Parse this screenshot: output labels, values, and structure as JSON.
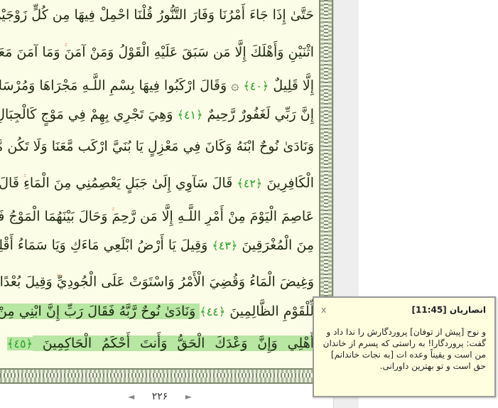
{
  "quran": {
    "lines": [
      {
        "parts": [
          {
            "t": "حَتَّىٰ إِذَا جَاءَ أَمْرُنَا وَفَارَ التَّنُّورُ قُلْنَا احْمِلْ فِيهَا مِن كُلٍّ زَوْجَيْنِ"
          }
        ]
      },
      {
        "parts": [
          {
            "t": "اثْنَيْنِ وَأَهْلَكَ إِلَّا مَن سَبَقَ عَلَيْهِ الْقَوْلُ وَمَنْ آمَنَ"
          },
          {
            "w": "ۚ"
          },
          {
            "t": " وَمَا آمَنَ مَعَهُ"
          }
        ]
      },
      {
        "parts": [
          {
            "t": "إِلَّا قَلِيلٌ "
          },
          {
            "a": "﴿٤٠﴾"
          },
          {
            "t": " ۞ وَقَالَ ارْكَبُوا فِيهَا بِسْمِ اللَّـهِ مَجْرَاهَا وَمُرْسَاهَا"
          },
          {
            "w": "ۚ"
          }
        ]
      },
      {
        "parts": [
          {
            "t": "إِنَّ رَبِّي لَغَفُورٌ رَّحِيمٌ "
          },
          {
            "a": "﴿٤١﴾"
          },
          {
            "t": " وَهِيَ تَجْرِي بِهِمْ فِي مَوْجٍ كَالْجِبَالِ"
          }
        ]
      },
      {
        "parts": [
          {
            "t": "وَنَادَىٰ نُوحٌ ابْنَهُ وَكَانَ فِي مَعْزِلٍ يَا بُنَيَّ ارْكَب مَّعَنَا وَلَا تَكُن مَّعَ"
          }
        ]
      },
      {
        "parts": [
          {
            "t": "الْكَافِرِينَ "
          },
          {
            "a": "﴿٤٢﴾"
          },
          {
            "t": " قَالَ سَآوِي إِلَىٰ جَبَلٍ يَعْصِمُنِي مِنَ الْمَاءِ"
          },
          {
            "w": "ۚ"
          },
          {
            "t": " قَالَ لَا"
          }
        ]
      },
      {
        "parts": [
          {
            "t": "عَاصِمَ الْيَوْمَ مِنْ أَمْرِ اللَّـهِ إِلَّا مَن رَّحِمَ"
          },
          {
            "w": "ۚ"
          },
          {
            "t": " وَحَالَ بَيْنَهُمَا الْمَوْجُ فَكَانَ"
          }
        ]
      },
      {
        "parts": [
          {
            "t": "مِنَ الْمُغْرَقِينَ "
          },
          {
            "a": "﴿٤٣﴾"
          },
          {
            "t": " وَقِيلَ يَا أَرْضُ ابْلَعِي مَاءَكِ وَيَا سَمَاءُ أَقْلِعِي"
          }
        ]
      },
      {
        "parts": [
          {
            "t": "وَغِيضَ الْمَاءُ وَقُضِيَ الْأَمْرُ وَاسْتَوَتْ عَلَى الْجُودِيِّ"
          },
          {
            "w": "ۖ"
          },
          {
            "t": " وَقِيلَ بُعْدًا"
          }
        ]
      },
      {
        "parts": [
          {
            "t": "لِّلْقَوْمِ الظَّالِمِينَ "
          },
          {
            "a": "﴿٤٤﴾"
          },
          {
            "h": " وَنَادَىٰ نُوحٌ رَّبَّهُ فَقَالَ رَبِّ إِنَّ ابْنِي مِنْ"
          }
        ]
      },
      {
        "parts": [
          {
            "h": "أَهْلِي وَإِنَّ وَعْدَكَ الْحَقُّ وَأَنتَ أَحْكَمُ الْحَاكِمِينَ "
          },
          {
            "ha": "﴿٤٥﴾"
          }
        ]
      }
    ]
  },
  "pager": {
    "prev_arrow": "◄",
    "page_number": "۲۲۶",
    "next_arrow": "►"
  },
  "popup": {
    "close_label": "x",
    "title": "انصاریان [11:45]",
    "body": "و نوح [پیش از توفان] پروردگارش را ندا داد و گفت: پروردگارا! به راستی که پسرم از خاندان من است و یقیناً وعده ات [به نجات خاندانم] حق است و تو بهترین داورانی."
  },
  "colors": {
    "page_bg": "#fcfde7",
    "ayah_marker": "#22a322",
    "highlight": "#b8e6a3",
    "popup_bg": "#ffffe0"
  }
}
